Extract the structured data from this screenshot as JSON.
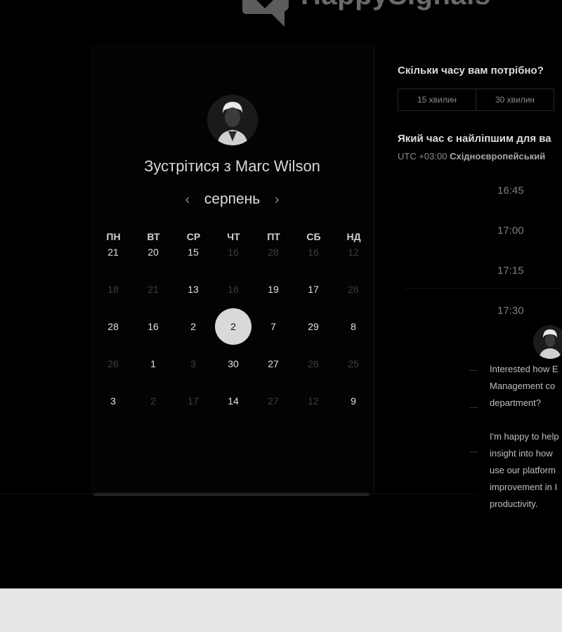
{
  "brand": {
    "name": "HappySignals"
  },
  "booking": {
    "title": "Зустрітися з Marc Wilson",
    "month": "серпень",
    "prev_arrow": "‹",
    "next_arrow": "›",
    "weekdays": [
      "ПН",
      "ВТ",
      "СР",
      "ЧТ",
      "ПТ",
      "СБ",
      "НД"
    ],
    "weeks": [
      [
        {
          "d": "21",
          "m": false
        },
        {
          "d": "20",
          "m": false
        },
        {
          "d": "15",
          "m": false
        },
        {
          "d": "16",
          "m": true
        },
        {
          "d": "28",
          "m": true
        },
        {
          "d": "16",
          "m": true
        },
        {
          "d": "12",
          "m": true
        }
      ],
      [
        {
          "d": "18",
          "m": true
        },
        {
          "d": "21",
          "m": true
        },
        {
          "d": "13",
          "m": false
        },
        {
          "d": "16",
          "m": true
        },
        {
          "d": "19",
          "m": false
        },
        {
          "d": "17",
          "m": false
        },
        {
          "d": "28",
          "m": true
        }
      ],
      [
        {
          "d": "28",
          "m": false
        },
        {
          "d": "16",
          "m": false
        },
        {
          "d": "2",
          "m": false
        },
        {
          "d": "2",
          "m": false,
          "selected": true
        },
        {
          "d": "7",
          "m": false
        },
        {
          "d": "29",
          "m": false
        },
        {
          "d": "8",
          "m": false
        }
      ],
      [
        {
          "d": "26",
          "m": true
        },
        {
          "d": "1",
          "m": false
        },
        {
          "d": "3",
          "m": true
        },
        {
          "d": "30",
          "m": false
        },
        {
          "d": "27",
          "m": false
        },
        {
          "d": "26",
          "m": true
        },
        {
          "d": "25",
          "m": true
        }
      ],
      [
        {
          "d": "3",
          "m": false
        },
        {
          "d": "2",
          "m": true
        },
        {
          "d": "17",
          "m": true
        },
        {
          "d": "14",
          "m": false
        },
        {
          "d": "27",
          "m": true
        },
        {
          "d": "12",
          "m": true
        },
        {
          "d": "9",
          "m": false
        }
      ]
    ]
  },
  "scheduler": {
    "duration_question": "Скільки часу вам потрібно?",
    "durations": [
      "15 хвилин",
      "30 хвилин"
    ],
    "time_question": "Який час є найліпшим для ва",
    "timezone_offset": "UTC +03:00",
    "timezone_name": "Східноєвропейський",
    "slots": [
      "16:45",
      "17:00",
      "17:15",
      "17:30"
    ]
  },
  "chat": {
    "message": "Interested how E\nManagement co\ndepartment?\n\nI'm happy to help\ninsight into how\nuse our platform\nimprovement in I\nproductivity."
  },
  "colors": {
    "background": "#000000",
    "selected_day": "#d9d9d9",
    "footer": "#e6e6e6"
  }
}
